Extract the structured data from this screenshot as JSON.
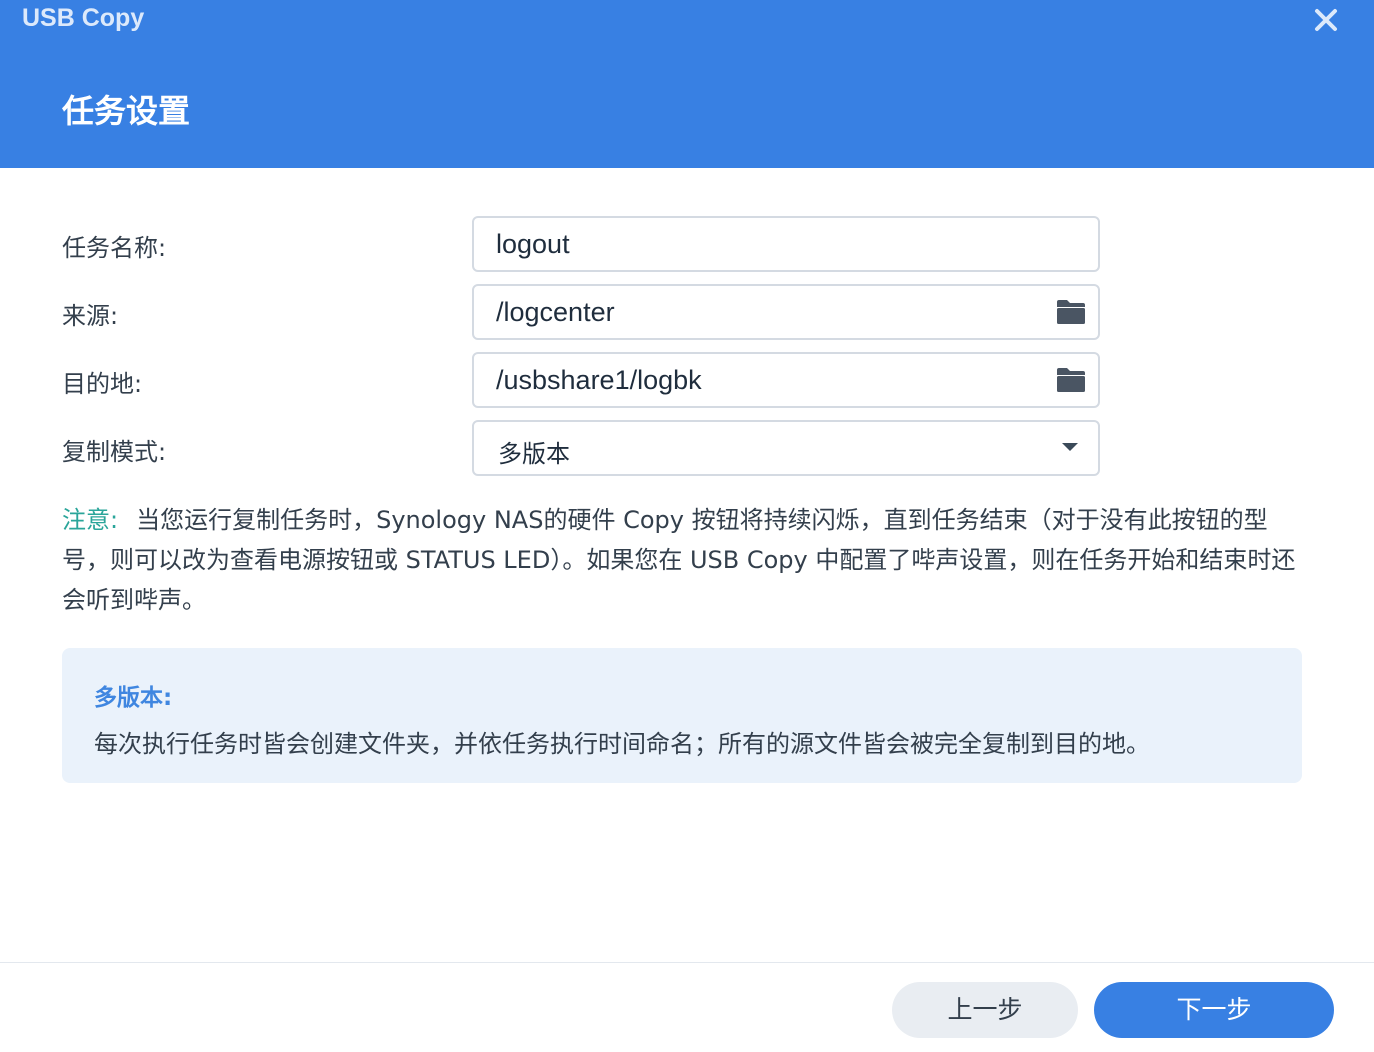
{
  "window": {
    "app_title": "USB Copy",
    "close_icon": "close-icon"
  },
  "wizard": {
    "step_title": "任务设置"
  },
  "form": {
    "task_name": {
      "label": "任务名称:",
      "value": "logout"
    },
    "source": {
      "label": "来源:",
      "value": "/logcenter",
      "icon": "folder-icon"
    },
    "destination": {
      "label": "目的地:",
      "value": "/usbshare1/logbk",
      "icon": "folder-icon"
    },
    "copy_mode": {
      "label": "复制模式:",
      "selected": "多版本",
      "icon": "chevron-down-icon"
    }
  },
  "note": {
    "label": "注意:",
    "text": "当您运行复制任务时，Synology NAS的硬件 Copy 按钮将持续闪烁，直到任务结束（对于没有此按钮的型号，则可以改为查看电源按钮或 STATUS LED）。如果您在 USB Copy 中配置了哔声设置，则在任务开始和结束时还会听到哔声。"
  },
  "info": {
    "title": "多版本:",
    "text": "每次执行任务时皆会创建文件夹，并依任务执行时间命名；所有的源文件皆会被完全复制到目的地。"
  },
  "footer": {
    "prev_label": "上一步",
    "next_label": "下一步"
  },
  "colors": {
    "header": "#3880e3",
    "note_label": "#2aa59a",
    "info_bg": "#eaf2fb",
    "info_title": "#3f86e0"
  }
}
